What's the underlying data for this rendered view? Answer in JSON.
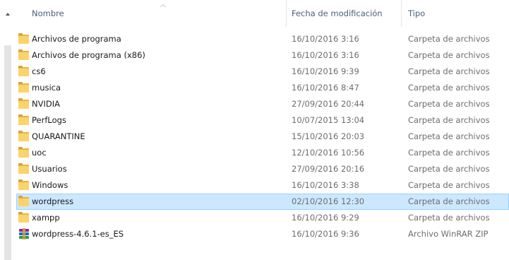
{
  "header": {
    "name_label": "Nombre",
    "date_label": "Fecha de modificación",
    "type_label": "Tipo"
  },
  "rows": [
    {
      "name": "Archivos de programa",
      "date": "16/10/2016 3:16",
      "type": "Carpeta de archivos",
      "icon": "folder-icon"
    },
    {
      "name": "Archivos de programa (x86)",
      "date": "16/10/2016 3:16",
      "type": "Carpeta de archivos",
      "icon": "folder-icon"
    },
    {
      "name": "cs6",
      "date": "16/10/2016 9:39",
      "type": "Carpeta de archivos",
      "icon": "folder-icon"
    },
    {
      "name": "musica",
      "date": "16/10/2016 8:47",
      "type": "Carpeta de archivos",
      "icon": "folder-icon"
    },
    {
      "name": "NVIDIA",
      "date": "27/09/2016 20:44",
      "type": "Carpeta de archivos",
      "icon": "folder-icon"
    },
    {
      "name": "PerfLogs",
      "date": "10/07/2015 13:04",
      "type": "Carpeta de archivos",
      "icon": "folder-icon"
    },
    {
      "name": "QUARANTINE",
      "date": "15/10/2016 20:03",
      "type": "Carpeta de archivos",
      "icon": "folder-icon"
    },
    {
      "name": "uoc",
      "date": "12/10/2016 10:56",
      "type": "Carpeta de archivos",
      "icon": "folder-icon"
    },
    {
      "name": "Usuarios",
      "date": "27/09/2016 20:16",
      "type": "Carpeta de archivos",
      "icon": "folder-icon"
    },
    {
      "name": "Windows",
      "date": "16/10/2016 3:38",
      "type": "Carpeta de archivos",
      "icon": "folder-icon"
    },
    {
      "name": "wordpress",
      "date": "02/10/2016 12:30",
      "type": "Carpeta de archivos",
      "icon": "folder-icon",
      "selected": true
    },
    {
      "name": "xampp",
      "date": "16/10/2016 9:29",
      "type": "Carpeta de archivos",
      "icon": "folder-icon"
    },
    {
      "name": "wordpress-4.6.1-es_ES",
      "date": "16/10/2016 9:36",
      "type": "Archivo WinRAR ZIP",
      "icon": "winrar-icon"
    }
  ],
  "colors": {
    "header_text": "#4c607a",
    "selection_bg": "#cce8ff",
    "selection_border": "#99d1ff",
    "folder": "#fcd36b"
  }
}
